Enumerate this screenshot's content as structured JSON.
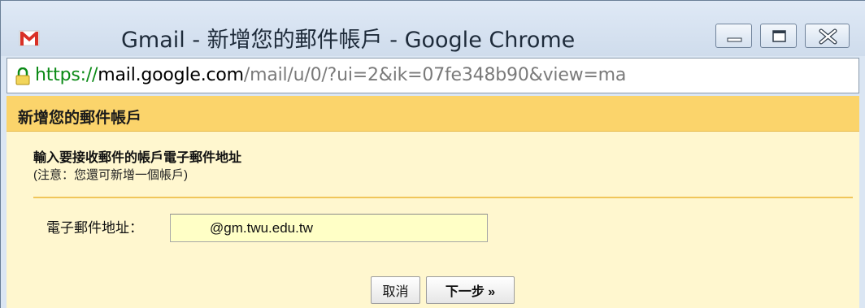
{
  "window": {
    "title": "Gmail - 新增您的郵件帳戶 - Google Chrome",
    "controls": [
      "minimize",
      "maximize",
      "close"
    ]
  },
  "address_bar": {
    "scheme": "https://",
    "host": "mail.google.com",
    "path": "/mail/u/0/?ui=2&ik=07fe348b90&view=ma",
    "secure_icon": "lock-icon"
  },
  "dialog": {
    "header": "新增您的郵件帳戶",
    "instruction": "輸入要接收郵件的帳戶電子郵件地址",
    "note": "(注意：您還可新增一個帳戶)",
    "email_label": "電子郵件地址：",
    "email_value": "@gm.twu.edu.tw",
    "buttons": {
      "cancel": "取消",
      "next": "下一步 »"
    }
  },
  "colors": {
    "header_bg": "#fbd46b",
    "content_bg": "#fff7cf",
    "input_bg": "#ffffc6",
    "secure_green": "#0b8a16"
  }
}
